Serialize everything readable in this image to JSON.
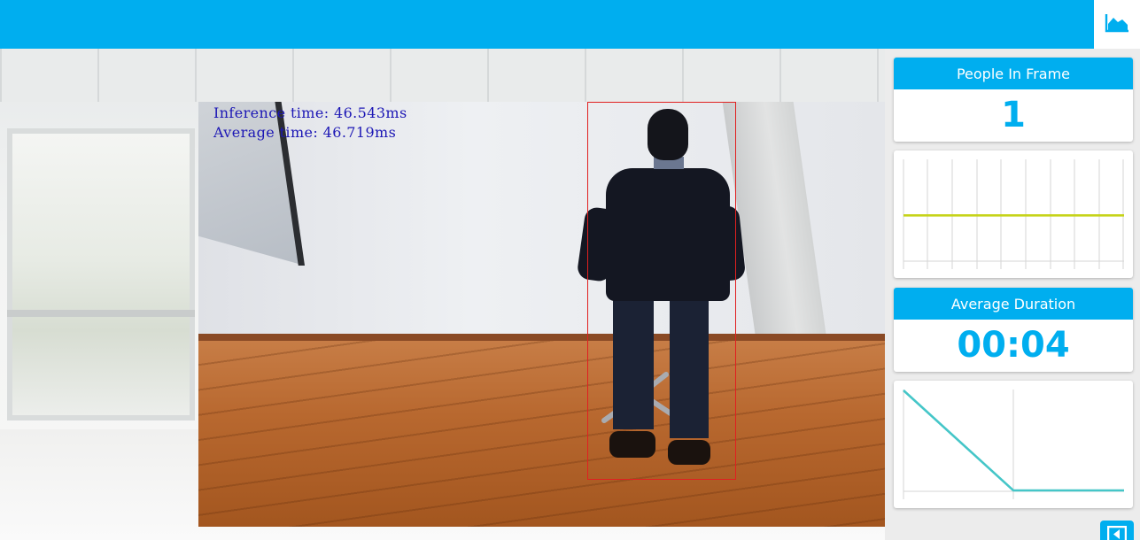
{
  "header": {
    "stats_icon": "area-chart-icon"
  },
  "video": {
    "overlay": {
      "inference_time": "Inference time: 46.543ms",
      "average_time": "Average time: 46.719ms"
    },
    "bounding_box_color": "#e02020",
    "overlay_text_color": "#1c17b5"
  },
  "stats": {
    "people_in_frame": {
      "title": "People In Frame",
      "value": "1"
    },
    "average_duration": {
      "title": "Average Duration",
      "value": "00:04"
    }
  },
  "charts": {
    "people_chart": {
      "line_color": "#c6d31a",
      "level": 0.45
    },
    "duration_chart": {
      "line_color": "#45c6c8"
    }
  },
  "corner_button": {
    "icon": "collapse-arrow-icon"
  },
  "colors": {
    "accent": "#00aeef",
    "panel_bg": "#ffffff"
  }
}
